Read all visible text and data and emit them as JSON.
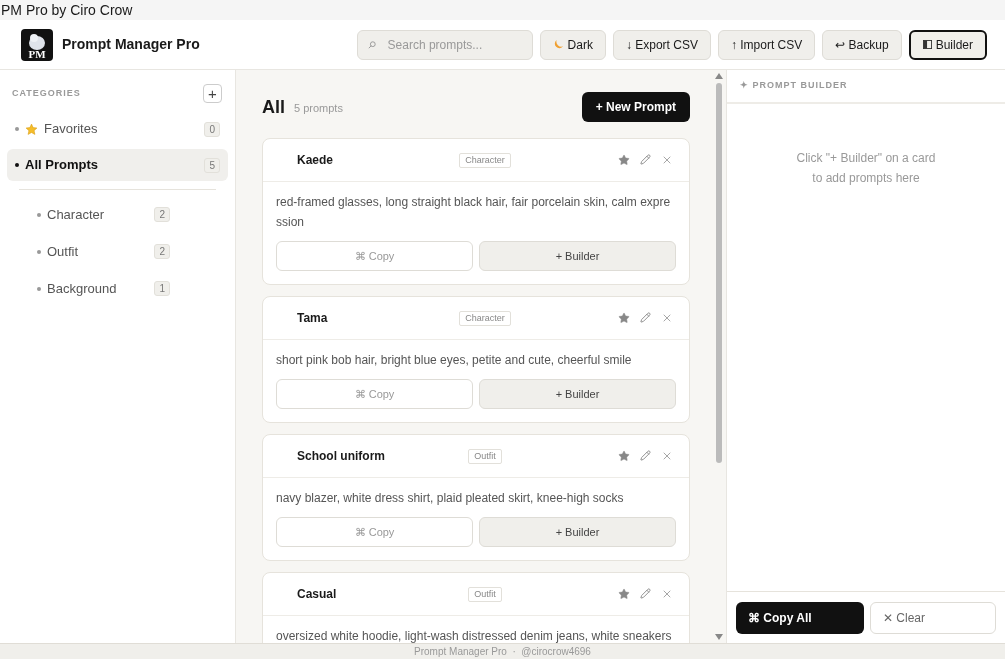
{
  "window": {
    "title": "PM Pro by Ciro Crow"
  },
  "header": {
    "logo_text": "PM",
    "app_name": "Prompt Manager Pro",
    "search": {
      "placeholder": "Search prompts..."
    },
    "buttons": [
      {
        "kind": "moon",
        "label": "Dark",
        "selected": false
      },
      {
        "kind": "plain",
        "label": "↓ Export CSV",
        "selected": false
      },
      {
        "kind": "plain",
        "label": "↑ Import CSV",
        "selected": false
      },
      {
        "kind": "plain",
        "label": "↩ Backup",
        "selected": false
      },
      {
        "kind": "panel",
        "label": "Builder",
        "selected": true
      }
    ]
  },
  "sidebar": {
    "heading": "CATEGORIES",
    "add_label": "+",
    "items": [
      {
        "kind": "favorites",
        "label": "Favorites",
        "count": "0",
        "selected": false
      },
      {
        "kind": "all",
        "label": "All Prompts",
        "count": "5",
        "selected": true
      },
      {
        "kind": "divider"
      },
      {
        "kind": "category",
        "label": "Character",
        "count": "2",
        "selected": false
      },
      {
        "kind": "category",
        "label": "Outfit",
        "count": "2",
        "selected": false
      },
      {
        "kind": "category",
        "label": "Background",
        "count": "1",
        "selected": false
      }
    ]
  },
  "main": {
    "title": "All",
    "count": "5 prompts",
    "new_button": "+ New Prompt",
    "cards": [
      {
        "name": "Kaede",
        "tag": "Character",
        "text": "red-framed glasses, long straight black hair, fair porcelain skin, calm expre ssion",
        "copy": "⌘ Copy",
        "builder": "+ Builder"
      },
      {
        "name": "Tama",
        "tag": "Character",
        "text": "short pink bob hair, bright blue eyes, petite and cute, cheerful smile",
        "copy": "⌘ Copy",
        "builder": "+ Builder"
      },
      {
        "name": "School uniform",
        "tag": "Outfit",
        "text": "navy blazer, white dress shirt, plaid pleated skirt, knee-high socks",
        "copy": "⌘ Copy",
        "builder": "+ Builder"
      },
      {
        "name": "Casual",
        "tag": "Outfit",
        "text": "oversized white hoodie, light-wash distressed denim jeans, white sneakers"
      }
    ]
  },
  "builder": {
    "heading": "✦ PROMPT BUILDER",
    "empty_lines": [
      "Click \"+ Builder\" on a card",
      "to add prompts here"
    ],
    "copy_all": "⌘ Copy All",
    "clear": "✕ Clear"
  },
  "footer": {
    "text": "Prompt Manager Pro  ·  @cirocrow4696"
  }
}
